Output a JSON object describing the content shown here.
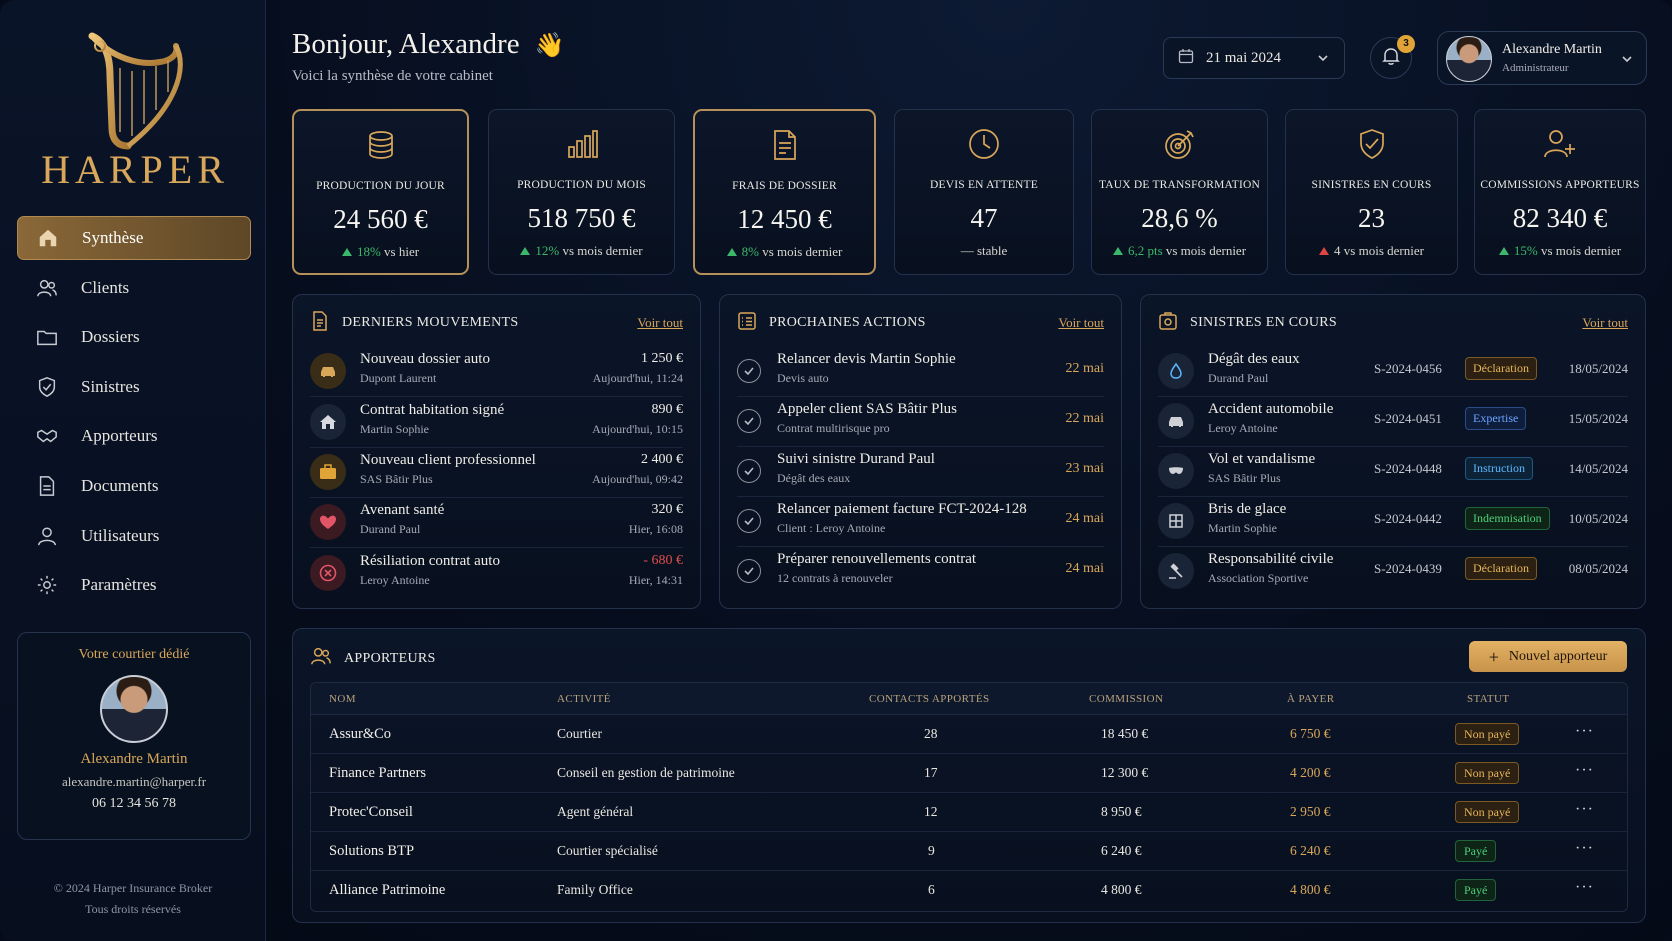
{
  "brand": {
    "name": "HARPER"
  },
  "nav": [
    {
      "label": "Synthèse",
      "icon": "home-icon",
      "active": true
    },
    {
      "label": "Clients",
      "icon": "users-icon"
    },
    {
      "label": "Dossiers",
      "icon": "folder-icon"
    },
    {
      "label": "Sinistres",
      "icon": "shield-icon"
    },
    {
      "label": "Apporteurs",
      "icon": "handshake-icon"
    },
    {
      "label": "Documents",
      "icon": "document-icon"
    },
    {
      "label": "Utilisateurs",
      "icon": "user-icon"
    },
    {
      "label": "Paramètres",
      "icon": "gear-icon"
    }
  ],
  "courier": {
    "title": "Votre courtier dédié",
    "name": "Alexandre Martin",
    "email": "alexandre.martin@harper.fr",
    "phone": "06 12 34 56 78"
  },
  "footer": {
    "line1": "© 2024 Harper Insurance Broker",
    "line2": "Tous droits réservés"
  },
  "header": {
    "greeting": "Bonjour, Alexandre",
    "wave": "👋",
    "subtitle": "Voici la synthèse de votre cabinet",
    "date": "21 mai 2024",
    "notifications": "3",
    "user_name": "Alexandre Martin",
    "user_role": "Administrateur"
  },
  "kpis": [
    {
      "label": "PRODUCTION DU JOUR",
      "value": "24 560 €",
      "delta": "18%",
      "suffix": "vs hier",
      "trend": "up",
      "icon": "coins-icon"
    },
    {
      "label": "PRODUCTION DU MOIS",
      "value": "518 750 €",
      "delta": "12%",
      "suffix": "vs mois dernier",
      "trend": "up",
      "icon": "bar-chart-icon"
    },
    {
      "label": "FRAIS DE DOSSIER",
      "value": "12 450 €",
      "delta": "8%",
      "suffix": "vs mois dernier",
      "trend": "up",
      "icon": "invoice-icon"
    },
    {
      "label": "DEVIS EN ATTENTE",
      "value": "47",
      "delta": "—",
      "suffix": "stable",
      "trend": "flat",
      "icon": "clock-icon"
    },
    {
      "label": "TAUX DE TRANSFORMATION",
      "value": "28,6 %",
      "delta": "6,2 pts",
      "suffix": "vs mois dernier",
      "trend": "up",
      "icon": "target-icon"
    },
    {
      "label": "SINISTRES EN COURS",
      "value": "23",
      "delta": "4",
      "suffix": "vs mois dernier",
      "trend": "down",
      "icon": "shield-check-icon"
    },
    {
      "label": "COMMISSIONS APPORTEURS",
      "value": "82 340 €",
      "delta": "15%",
      "suffix": "vs mois dernier",
      "trend": "up",
      "icon": "user-plus-icon"
    }
  ],
  "movements": {
    "title": "DERNIERS MOUVEMENTS",
    "link": "Voir tout",
    "items": [
      {
        "title": "Nouveau dossier auto",
        "sub": "Dupont Laurent",
        "amount": "1 250 €",
        "time": "Aujourd'hui, 11:24",
        "icon": "car-icon"
      },
      {
        "title": "Contrat habitation signé",
        "sub": "Martin Sophie",
        "amount": "890 €",
        "time": "Aujourd'hui, 10:15",
        "icon": "house-icon"
      },
      {
        "title": "Nouveau client professionnel",
        "sub": "SAS Bâtir Plus",
        "amount": "2 400 €",
        "time": "Aujourd'hui, 09:42",
        "icon": "briefcase-icon"
      },
      {
        "title": "Avenant santé",
        "sub": "Durand Paul",
        "amount": "320 €",
        "time": "Hier, 16:08",
        "icon": "heart-icon"
      },
      {
        "title": "Résiliation contrat auto",
        "sub": "Leroy Antoine",
        "amount": "- 680 €",
        "time": "Hier, 14:31",
        "icon": "cancel-icon"
      }
    ]
  },
  "actions": {
    "title": "PROCHAINES ACTIONS",
    "link": "Voir tout",
    "items": [
      {
        "title": "Relancer devis Martin Sophie",
        "sub": "Devis auto",
        "date": "22 mai"
      },
      {
        "title": "Appeler client SAS Bâtir Plus",
        "sub": "Contrat multirisque pro",
        "date": "22 mai"
      },
      {
        "title": "Suivi sinistre Durand Paul",
        "sub": "Dégât des eaux",
        "date": "23 mai"
      },
      {
        "title": "Relancer paiement facture FCT-2024-128",
        "sub": "Client : Leroy Antoine",
        "date": "24 mai"
      },
      {
        "title": "Préparer renouvellements contrat",
        "sub": "12 contrats à renouveler",
        "date": "24 mai"
      }
    ]
  },
  "claims": {
    "title": "SINISTRES EN COURS",
    "link": "Voir tout",
    "items": [
      {
        "title": "Dégât des eaux",
        "sub": "Durand Paul",
        "ref": "S-2024-0456",
        "status": "Déclaration",
        "kind": "decl",
        "date": "18/05/2024",
        "icon": "water-drop-icon"
      },
      {
        "title": "Accident automobile",
        "sub": "Leroy Antoine",
        "ref": "S-2024-0451",
        "status": "Expertise",
        "kind": "expe",
        "date": "15/05/2024",
        "icon": "car-icon"
      },
      {
        "title": "Vol et vandalisme",
        "sub": "SAS Bâtir Plus",
        "ref": "S-2024-0448",
        "status": "Instruction",
        "kind": "inst",
        "date": "14/05/2024",
        "icon": "mask-icon"
      },
      {
        "title": "Bris de glace",
        "sub": "Martin Sophie",
        "ref": "S-2024-0442",
        "status": "Indemnisation",
        "kind": "inde",
        "date": "10/05/2024",
        "icon": "window-icon"
      },
      {
        "title": "Responsabilité civile",
        "sub": "Association Sportive",
        "ref": "S-2024-0439",
        "status": "Déclaration",
        "kind": "decl",
        "date": "08/05/2024",
        "icon": "gavel-icon"
      }
    ]
  },
  "apporteurs": {
    "title": "APPORTEURS",
    "new_button": "Nouvel apporteur",
    "columns": [
      "NOM",
      "ACTIVITÉ",
      "CONTACTS APPORTÉS",
      "COMMISSION",
      "À PAYER",
      "STATUT"
    ],
    "rows": [
      {
        "name": "Assur&Co",
        "activity": "Courtier",
        "contacts": "28",
        "commission": "18 450 €",
        "due": "6 750 €",
        "status": "Non payé",
        "paid": false
      },
      {
        "name": "Finance Partners",
        "activity": "Conseil en gestion de patrimoine",
        "contacts": "17",
        "commission": "12 300 €",
        "due": "4 200 €",
        "status": "Non payé",
        "paid": false
      },
      {
        "name": "Protec'Conseil",
        "activity": "Agent général",
        "contacts": "12",
        "commission": "8 950 €",
        "due": "2 950 €",
        "status": "Non payé",
        "paid": false
      },
      {
        "name": "Solutions BTP",
        "activity": "Courtier spécialisé",
        "contacts": "9",
        "commission": "6 240 €",
        "due": "6 240 €",
        "status": "Payé",
        "paid": true
      },
      {
        "name": "Alliance Patrimoine",
        "activity": "Family Office",
        "contacts": "6",
        "commission": "4 800 €",
        "due": "4 800 €",
        "status": "Payé",
        "paid": true
      }
    ],
    "more": "···"
  },
  "colors": {
    "gold": "#d9a75a",
    "up": "#3bb86a",
    "down": "#e04444",
    "bg": "#060d1d"
  }
}
